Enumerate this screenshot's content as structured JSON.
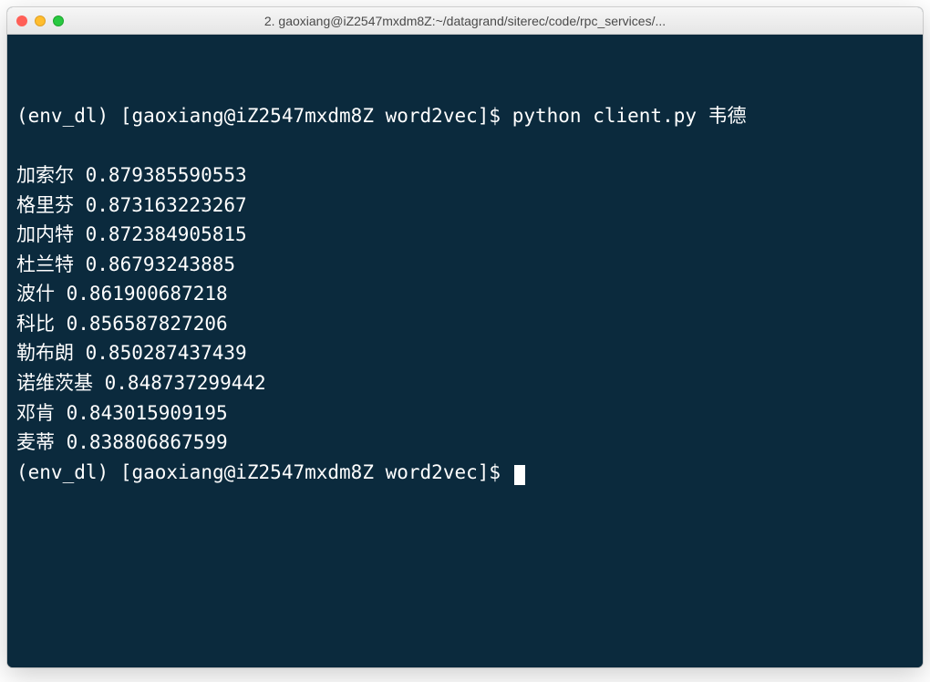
{
  "window": {
    "title": "2. gaoxiang@iZ2547mxdm8Z:~/datagrand/siterec/code/rpc_services/..."
  },
  "terminal": {
    "prompt_env": "(env_dl)",
    "prompt_userhost": "[gaoxiang@iZ2547mxdm8Z word2vec]$",
    "command": "python client.py 韦德",
    "results": [
      {
        "word": "加索尔",
        "score": "0.879385590553"
      },
      {
        "word": "格里芬",
        "score": "0.873163223267"
      },
      {
        "word": "加内特",
        "score": "0.872384905815"
      },
      {
        "word": "杜兰特",
        "score": "0.86793243885"
      },
      {
        "word": "波什",
        "score": "0.861900687218"
      },
      {
        "word": "科比",
        "score": "0.856587827206"
      },
      {
        "word": "勒布朗",
        "score": "0.850287437439"
      },
      {
        "word": "诺维茨基",
        "score": "0.848737299442"
      },
      {
        "word": "邓肯",
        "score": "0.843015909195"
      },
      {
        "word": "麦蒂",
        "score": "0.838806867599"
      }
    ]
  }
}
